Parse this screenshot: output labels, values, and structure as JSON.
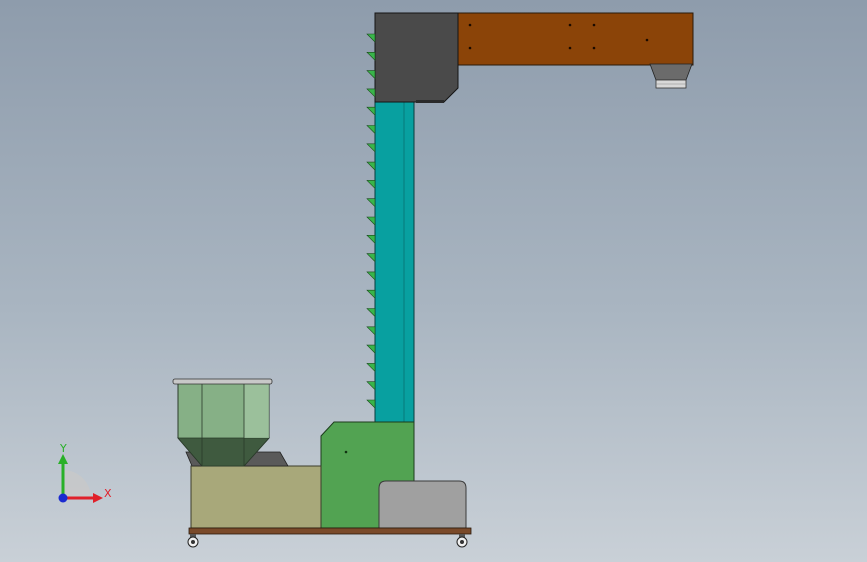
{
  "viewport": {
    "background_top": "#8e9cac",
    "background_bottom": "#c9d0d7"
  },
  "colors": {
    "top_housing": "#4a4a4a",
    "horizontal_conveyor": "#8b4408",
    "vertical_column": "#08a0a0",
    "base_housing": "#52a352",
    "feeder_box": "#a8a87a",
    "hopper": "#86b086",
    "motor_cover": "#a0a0a0",
    "bucket_teeth": "#39b54a",
    "frame": "#7a4a2a"
  },
  "triad": {
    "x_label": "X",
    "y_label": "Y",
    "x_color": "#e0202a",
    "y_color": "#28b028",
    "z_color": "#1a2ad0"
  }
}
